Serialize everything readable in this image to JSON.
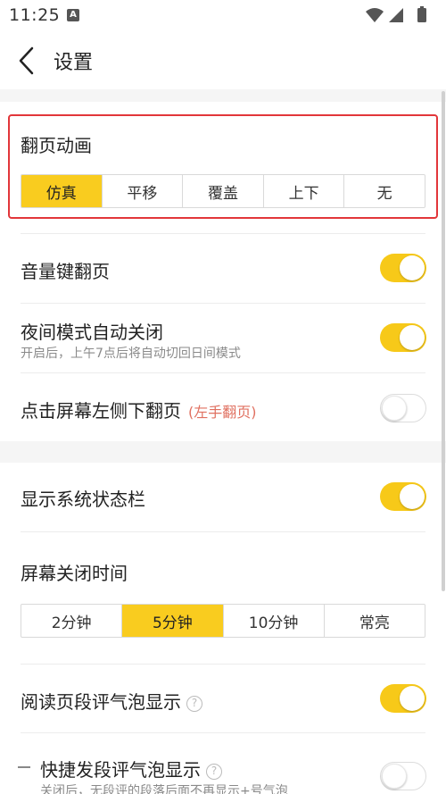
{
  "status": {
    "time": "11:25",
    "notif_letter": "A"
  },
  "header": {
    "title": "设置"
  },
  "flip_animation": {
    "title": "翻页动画",
    "options": [
      "仿真",
      "平移",
      "覆盖",
      "上下",
      "无"
    ],
    "selected": "仿真"
  },
  "settings": [
    {
      "label": "音量键翻页",
      "on": true
    },
    {
      "label": "夜间模式自动关闭",
      "sub": "开启后，上午7点后将自动切回日间模式",
      "on": true
    },
    {
      "label": "点击屏幕左侧下翻页",
      "hint": "(左手翻页)",
      "on": false
    },
    {
      "label": "显示系统状态栏",
      "on": true
    }
  ],
  "screen_off": {
    "title": "屏幕关闭时间",
    "options": [
      "2分钟",
      "5分钟",
      "10分钟",
      "常亮"
    ],
    "selected": "5分钟"
  },
  "bubble": {
    "label": "阅读页段评气泡显示",
    "help": "?",
    "on": true
  },
  "quick_bubble": {
    "label": "快捷发段评气泡显示",
    "help": "?",
    "sub": "关闭后，无段评的段落后面不再显示+号气泡",
    "on": false
  },
  "colors": {
    "accent": "#f9cc1f",
    "highlight": "#e2363a"
  }
}
